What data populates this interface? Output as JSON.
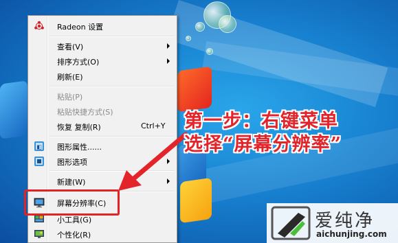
{
  "menu": {
    "items": [
      {
        "label": "Radeon 设置",
        "icon": "radeon-icon"
      },
      {
        "label": "查看(V)",
        "submenu": true
      },
      {
        "label": "排序方式(O)",
        "submenu": true
      },
      {
        "label": "刷新(E)"
      },
      {
        "label": "粘贴(P)",
        "disabled": true
      },
      {
        "label": "粘贴快捷方式(S)",
        "disabled": true
      },
      {
        "label": "恢复 复制(R)",
        "shortcut": "Ctrl+Y"
      },
      {
        "label": "图形属性......",
        "icon": "graphics-properties-icon"
      },
      {
        "label": "图形选项",
        "icon": "graphics-options-icon",
        "submenu": true
      },
      {
        "label": "新建(W)",
        "submenu": true
      },
      {
        "label": "屏幕分辨率(C)",
        "icon": "screen-resolution-icon",
        "highlighted": true
      },
      {
        "label": "小工具(G)",
        "icon": "gadgets-icon"
      },
      {
        "label": "个性化(R)",
        "icon": "personalize-icon"
      }
    ]
  },
  "annotation": {
    "line1": "第一步：右键菜单",
    "line2": "选择“屏幕分辨率”",
    "color": "#e3242b"
  },
  "watermark": {
    "name": "爱纯净",
    "url": "aichunjing.com"
  }
}
